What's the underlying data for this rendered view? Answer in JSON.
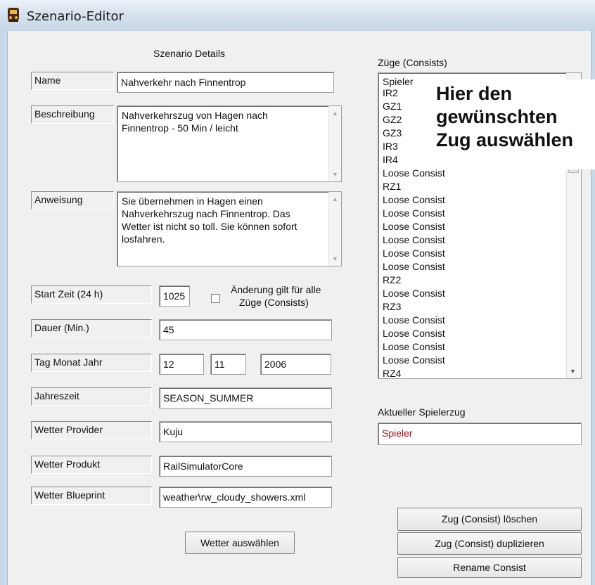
{
  "window": {
    "title": "Szenario-Editor"
  },
  "details": {
    "heading": "Szenario Details",
    "name_label": "Name",
    "name_value": "Nahverkehr nach Finnentrop",
    "description_label": "Beschreibung",
    "description_lines": [
      "Nahverkehrszug von Hagen nach",
      "Finnentrop  -  50 Min / leicht"
    ],
    "instruction_label": "Anweisung",
    "instruction_lines": [
      "Sie übernehmen in Hagen einen",
      "Nahverkehrszug nach Finnentrop. Das",
      "Wetter ist nicht so toll. Sie können sofort",
      "losfahren."
    ],
    "start_label": "Start Zeit (24 h)",
    "start_value": "1025",
    "apply_all_line1": "Änderung gilt für alle",
    "apply_all_line2": "Züge (Consists)",
    "apply_all_checked": false,
    "duration_label": "Dauer (Min.)",
    "duration_value": "45",
    "date_label": "Tag Monat Jahr",
    "day_value": "12",
    "month_value": "11",
    "year_value": "2006",
    "season_label": "Jahreszeit",
    "season_value": "SEASON_SUMMER",
    "weather_provider_label": "Wetter Provider",
    "weather_provider_value": "Kuju",
    "weather_product_label": "Wetter Produkt",
    "weather_product_value": "RailSimulatorCore",
    "weather_blueprint_label": "Wetter Blueprint",
    "weather_blueprint_value": "weather\\rw_cloudy_showers.xml",
    "select_weather_button": "Wetter auswählen"
  },
  "consists": {
    "heading": "Züge (Consists)",
    "items": [
      "Spieler",
      "IR2",
      "GZ1",
      "GZ2",
      "GZ3",
      "IR3",
      "IR4",
      "Loose Consist",
      "RZ1",
      "Loose Consist",
      "Loose Consist",
      "Loose Consist",
      "Loose Consist",
      "Loose Consist",
      "Loose Consist",
      "RZ2",
      "Loose Consist",
      "RZ3",
      "Loose Consist",
      "Loose Consist",
      "Loose Consist",
      "Loose Consist",
      "RZ4"
    ],
    "current_label": "Aktueller Spielerzug",
    "current_value": "Spieler",
    "current_value_color": "#a0141e",
    "delete_button": "Zug (Consist) löschen",
    "duplicate_button": "Zug (Consist) duplizieren",
    "rename_button": "Rename Consist"
  },
  "annotation": {
    "lines": [
      "Hier den",
      "gewünschten",
      "Zug auswählen"
    ]
  }
}
